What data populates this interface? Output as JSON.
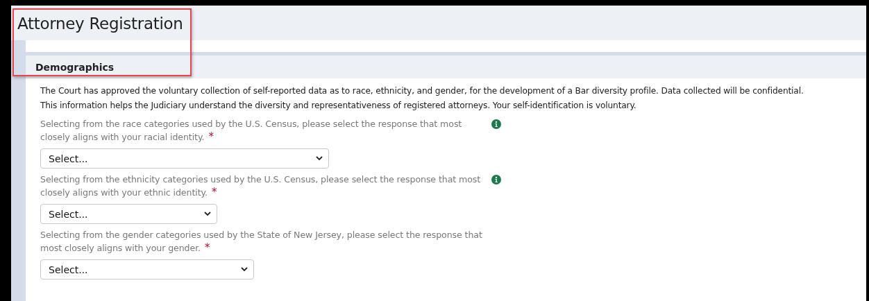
{
  "page_title": "Attorney Registration",
  "section": {
    "title": "Demographics",
    "intro": [
      "The Court has approved the voluntary collection of self-reported data as to race, ethnicity, and gender, for the development of a Bar diversity profile. Data collected will be confidential.",
      "This information helps the Judiciary understand the diversity and representativeness of registered attorneys. Your self-identification is voluntary."
    ],
    "questions": [
      {
        "label": "Selecting from the race categories used by the U.S. Census, please select the response that most closely aligns with your racial identity.",
        "required_mark": "*",
        "info": true,
        "value": "Select..."
      },
      {
        "label": "Selecting from the ethnicity categories used by the U.S. Census, please select the response that most closely aligns with your ethnic identity.",
        "required_mark": "*",
        "info": true,
        "value": "Select..."
      },
      {
        "label": "Selecting from the gender categories used by the State of New Jersey, please select the response that most closely aligns with your gender.",
        "required_mark": "*",
        "info": false,
        "value": "Select..."
      }
    ]
  }
}
